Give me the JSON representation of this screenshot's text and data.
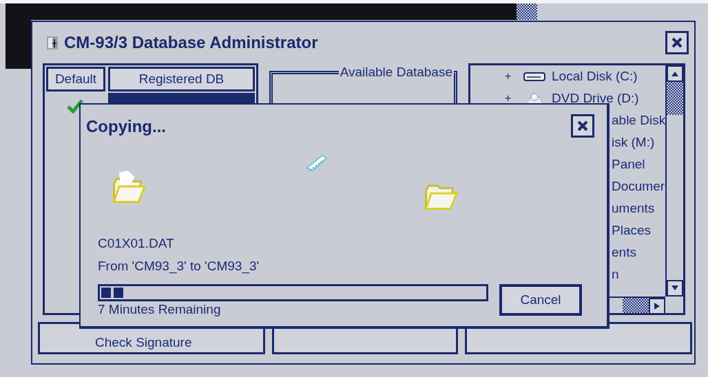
{
  "window": {
    "title": "CM-93/3 Database Administrator"
  },
  "registered_list": {
    "columns": [
      "Default",
      "Registered DB"
    ],
    "rows": [
      {
        "default": true,
        "selected": true
      }
    ]
  },
  "available_group": {
    "title": "Available Database"
  },
  "drive_tree": {
    "items": [
      {
        "kind": "drive",
        "expander": "+",
        "label": "Local Disk (C:)"
      },
      {
        "kind": "dvd",
        "expander": "+",
        "label": "DVD Drive (D:)"
      },
      {
        "kind": "partial",
        "label": "able Disk"
      },
      {
        "kind": "partial",
        "label": "isk (M:)"
      },
      {
        "kind": "partial",
        "label": "Panel"
      },
      {
        "kind": "partial",
        "label": "Documer"
      },
      {
        "kind": "partial",
        "label": "uments"
      },
      {
        "kind": "partial",
        "label": "Places"
      },
      {
        "kind": "partial",
        "label": "ents"
      },
      {
        "kind": "partial",
        "label": "n"
      }
    ]
  },
  "buttons": [
    {
      "label": "Check Signature"
    }
  ],
  "dialog": {
    "title": "Copying...",
    "file": "C01X01.DAT",
    "route": "From 'CM93_3' to 'CM93_3'",
    "progress": {
      "level": 0.06
    },
    "cancel": "Cancel",
    "remaining": "7 Minutes Remaining"
  }
}
